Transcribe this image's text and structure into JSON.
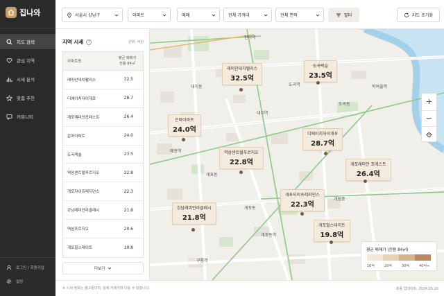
{
  "app": {
    "name": "집나와"
  },
  "sidebar": {
    "items": [
      {
        "label": "지도 검색",
        "icon": "search-icon",
        "active": true
      },
      {
        "label": "관심 지역",
        "icon": "heart-icon",
        "active": false
      },
      {
        "label": "시세 분석",
        "icon": "bar-chart-icon",
        "active": false
      },
      {
        "label": "맞춤 추천",
        "icon": "star-icon",
        "active": false
      },
      {
        "label": "커뮤니티",
        "icon": "chat-icon",
        "active": false
      }
    ],
    "bottom": [
      {
        "label": "로그인 / 회원가입",
        "icon": "user-icon"
      },
      {
        "label": "설정",
        "icon": "gear-icon"
      }
    ]
  },
  "topbar": {
    "location": "서울시 강남구",
    "type": "아파트",
    "deal": "매매",
    "price": "전체 가격대",
    "area": "전체 면적",
    "filter_label": "필터",
    "reset_label": "지도 초기화"
  },
  "panel": {
    "title": "지역 시세",
    "unit": "단위: 억원",
    "col_name": "아파트명",
    "col_price_1": "평균 매매가",
    "col_price_2": "전용 84㎡",
    "rows": [
      {
        "name": "래미안대치팰리스",
        "price": "32.5"
      },
      {
        "name": "디에이치자이개포",
        "price": "28.7"
      },
      {
        "name": "개포래미안포레스트",
        "price": "26.4"
      },
      {
        "name": "은마아파트",
        "price": "24.0"
      },
      {
        "name": "도곡렉슬",
        "price": "23.5"
      },
      {
        "name": "역삼센트럴푸르지오",
        "price": "22.8"
      },
      {
        "name": "개포자이프레지던스",
        "price": "22.3"
      },
      {
        "name": "강남래미안라클래시",
        "price": "21.8"
      },
      {
        "name": "역삼푸르지오",
        "price": "20.6"
      },
      {
        "name": "개포힐스테이트",
        "price": "19.8"
      }
    ],
    "more_label": "더보기"
  },
  "map": {
    "areas": [
      "한티역",
      "대치동",
      "도곡역",
      "학여울역",
      "도곡동",
      "대치역",
      "매봉역",
      "개포동",
      "개포동",
      "개포동역",
      "구룡역",
      "개원중"
    ],
    "callouts": [
      {
        "name": "래미안대치팰리스",
        "price": "32.5억"
      },
      {
        "name": "도곡렉슬",
        "price": "23.5억"
      },
      {
        "name": "은마아파트",
        "price": "24.0억"
      },
      {
        "name": "디에이치자이개포",
        "price": "28.7억"
      },
      {
        "name": "역삼센트럴푸르지오",
        "price": "22.8억"
      },
      {
        "name": "개포래미안 포레스트",
        "price": "26.4억"
      },
      {
        "name": "개포자이프레지던스",
        "price": "22.3억"
      },
      {
        "name": "강남래미안라클래시",
        "price": "21.8억"
      },
      {
        "name": "개포힐스테이트",
        "price": "19.8억"
      }
    ],
    "zoom_in": "+",
    "zoom_out": "−"
  },
  "legend": {
    "title": "평균 매매가 (전용 84㎡)",
    "labels": [
      "10억",
      "20억",
      "30억",
      "40억+"
    ],
    "colors": [
      "#f3e8d6",
      "#e7d3b3",
      "#d5b58c",
      "#b88b5c"
    ]
  },
  "footer": {
    "note": "※ 시세 정보는 참고용이며, 실제 거래가와 다를 수 있습니다.",
    "updated": "최종 업데이트: 2024.05.20"
  },
  "colors": {
    "accent": "#c9a06a",
    "sidebar_bg": "#2a2a2a",
    "water": "#a9d6ef",
    "park": "#cfe3c6"
  }
}
